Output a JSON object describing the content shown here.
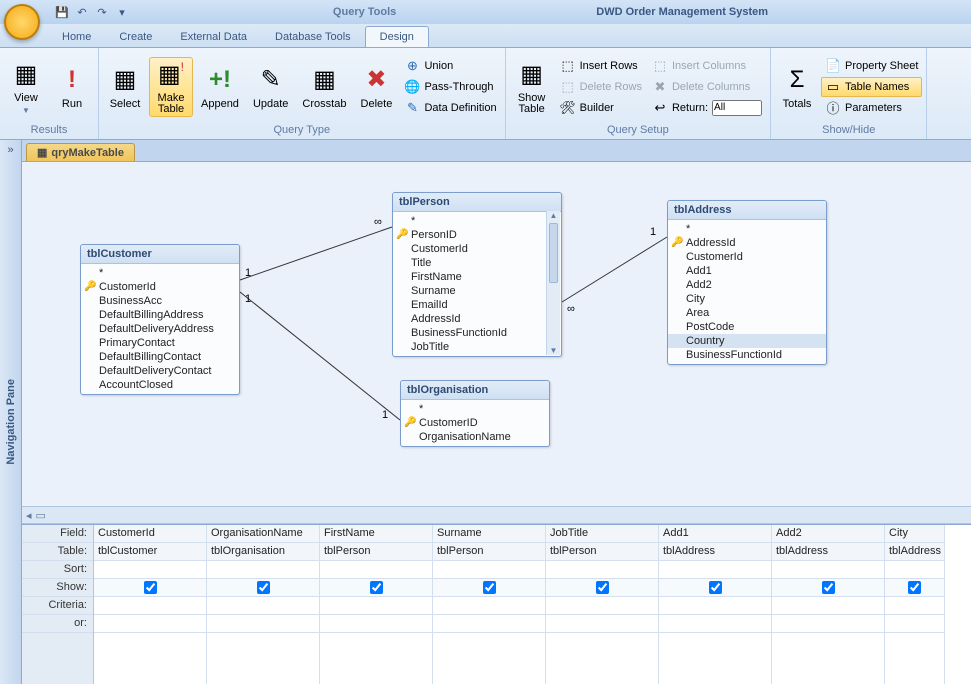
{
  "titlebar": {
    "context_group": "Query Tools",
    "app_title": "DWD Order Management System"
  },
  "tabs": [
    "Home",
    "Create",
    "External Data",
    "Database Tools",
    "Design"
  ],
  "active_tab": "Design",
  "ribbon": {
    "results": {
      "label": "Results",
      "view": "View",
      "run": "Run"
    },
    "querytype": {
      "label": "Query Type",
      "select": "Select",
      "maketable": "Make\nTable",
      "append": "Append",
      "update": "Update",
      "crosstab": "Crosstab",
      "delete": "Delete",
      "union": "Union",
      "passthrough": "Pass-Through",
      "datadef": "Data Definition"
    },
    "querysetup": {
      "label": "Query Setup",
      "showtable": "Show\nTable",
      "insertrows": "Insert Rows",
      "deleterows": "Delete Rows",
      "builder": "Builder",
      "insertcols": "Insert Columns",
      "deletecols": "Delete Columns",
      "return": "Return:",
      "return_val": "All"
    },
    "showhide": {
      "label": "Show/Hide",
      "totals": "Totals",
      "propsheet": "Property Sheet",
      "tablenames": "Table Names",
      "parameters": "Parameters"
    }
  },
  "nav_pane_label": "Navigation Pane",
  "object_tab": "qryMakeTable",
  "tables": {
    "customer": {
      "title": "tblCustomer",
      "star": "*",
      "fields": [
        "CustomerId",
        "BusinessAcc",
        "DefaultBillingAddress",
        "DefaultDeliveryAddress",
        "PrimaryContact",
        "DefaultBillingContact",
        "DefaultDeliveryContact",
        "AccountClosed"
      ],
      "pk_index": 0
    },
    "person": {
      "title": "tblPerson",
      "star": "*",
      "fields": [
        "PersonID",
        "CustomerId",
        "Title",
        "FirstName",
        "Surname",
        "EmailId",
        "AddressId",
        "BusinessFunctionId",
        "JobTitle"
      ],
      "pk_index": 0
    },
    "organisation": {
      "title": "tblOrganisation",
      "star": "*",
      "fields": [
        "CustomerID",
        "OrganisationName"
      ],
      "pk_index": 0
    },
    "address": {
      "title": "tblAddress",
      "star": "*",
      "fields": [
        "AddressId",
        "CustomerId",
        "Add1",
        "Add2",
        "City",
        "Area",
        "PostCode",
        "Country",
        "BusinessFunctionId"
      ],
      "pk_index": 0,
      "selected_index": 7
    }
  },
  "rel_labels": {
    "one": "1",
    "many": "∞"
  },
  "grid": {
    "row_labels": [
      "Field:",
      "Table:",
      "Sort:",
      "Show:",
      "Criteria:",
      "or:"
    ],
    "columns": [
      {
        "field": "CustomerId",
        "table": "tblCustomer",
        "show": true
      },
      {
        "field": "OrganisationName",
        "table": "tblOrganisation",
        "show": true
      },
      {
        "field": "FirstName",
        "table": "tblPerson",
        "show": true
      },
      {
        "field": "Surname",
        "table": "tblPerson",
        "show": true
      },
      {
        "field": "JobTitle",
        "table": "tblPerson",
        "show": true
      },
      {
        "field": "Add1",
        "table": "tblAddress",
        "show": true
      },
      {
        "field": "Add2",
        "table": "tblAddress",
        "show": true
      },
      {
        "field": "City",
        "table": "tblAddress",
        "show": true
      }
    ]
  }
}
